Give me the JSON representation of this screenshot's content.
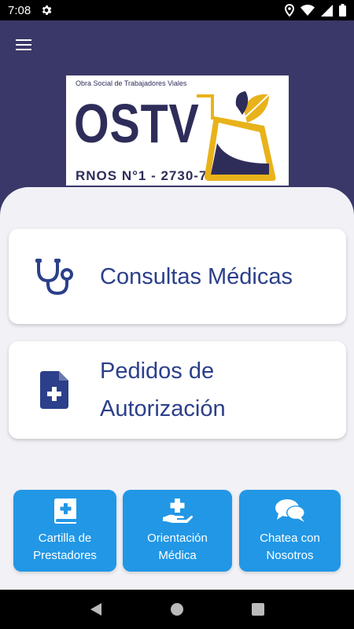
{
  "status_bar": {
    "time": "7:08",
    "icons": [
      "settings-icon",
      "location-icon",
      "wifi-icon",
      "signal-icon",
      "battery-icon"
    ]
  },
  "header": {
    "menu_icon": "hamburger-menu-icon",
    "background_color": "#3a3868"
  },
  "logo": {
    "subtitle": "Obra Social de Trabajadores Viales",
    "name": "OSTV",
    "registration": "RNOS N°1 - 2730-7",
    "colors": {
      "navy": "#2e2d5a",
      "gold": "#e8b21a"
    }
  },
  "cards": [
    {
      "label": "Consultas Médicas",
      "icon": "stethoscope-icon"
    },
    {
      "label_line1": "Pedidos de",
      "label_line2": "Autorización",
      "icon": "medical-document-icon"
    }
  ],
  "quick_actions": [
    {
      "line1": "Cartilla de",
      "line2": "Prestadores",
      "icon": "medical-book-icon"
    },
    {
      "line1": "Orientación",
      "line2": "Médica",
      "icon": "hand-medical-icon"
    },
    {
      "line1": "Chatea con",
      "line2": "Nosotros",
      "icon": "chat-bubbles-icon"
    }
  ],
  "theme": {
    "card_text_color": "#2b3f8a",
    "quick_action_color": "#2197e6",
    "content_background": "#f1f1f6"
  },
  "nav_bar": {
    "buttons": [
      "back-icon",
      "home-icon",
      "recents-icon"
    ]
  }
}
